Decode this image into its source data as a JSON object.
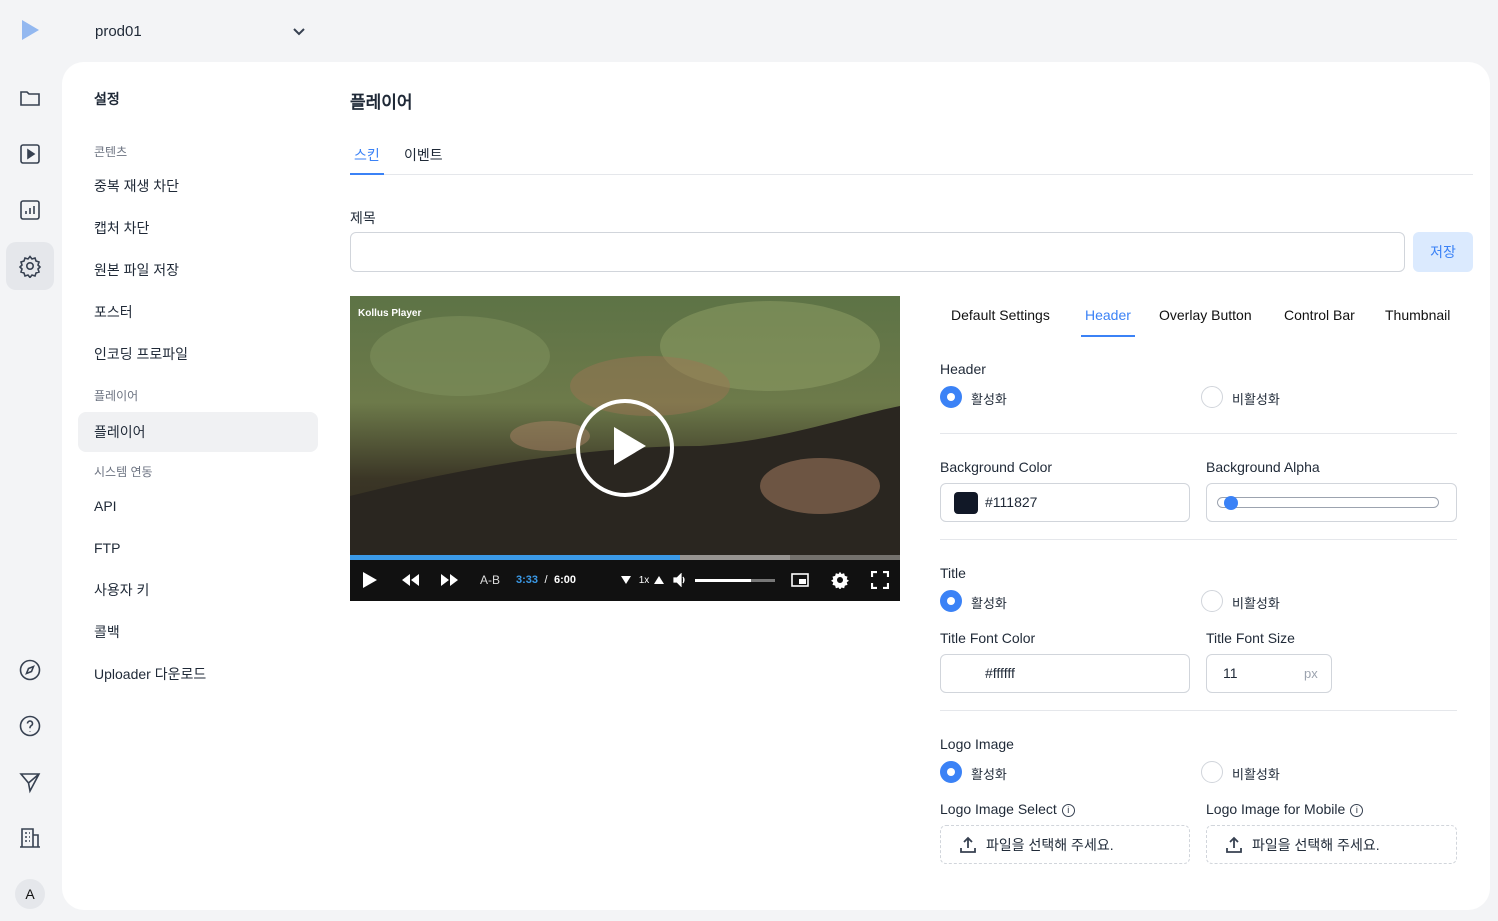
{
  "project": {
    "name": "prod01"
  },
  "nav": {
    "rail": [
      "folder-icon",
      "play-icon",
      "chart-icon",
      "gear-icon",
      "compass-icon",
      "help-icon",
      "send-icon",
      "building-icon"
    ],
    "avatar": "A"
  },
  "sidebar": {
    "title": "설정",
    "sections": [
      {
        "label": "콘텐츠",
        "items": [
          "중복 재생 차단",
          "캡처 차단",
          "원본 파일 저장",
          "포스터",
          "인코딩 프로파일"
        ]
      },
      {
        "label": "플레이어",
        "items": [
          "플레이어"
        ]
      },
      {
        "label": "시스템 연동",
        "items": [
          "API",
          "FTP",
          "사용자 키",
          "콜백",
          "Uploader 다운로드"
        ]
      }
    ],
    "active": "플레이어"
  },
  "page": {
    "title": "플레이어",
    "tabs": [
      {
        "label": "스킨",
        "active": true
      },
      {
        "label": "이벤트",
        "active": false
      }
    ],
    "name_label": "제목",
    "name_value": "",
    "save_label": "저장"
  },
  "player": {
    "brand": "Kollus Player",
    "ab_label": "A-B",
    "current_time": "3:33",
    "separator": "/",
    "duration": "6:00",
    "speed": "1x",
    "progress": 0.6,
    "buffered": 0.8,
    "volume": 0.7
  },
  "settings": {
    "tabs": [
      "Default Settings",
      "Header",
      "Overlay Button",
      "Control Bar",
      "Thumbnail"
    ],
    "active_tab": "Header",
    "enable_label": "활성화",
    "disable_label": "비활성화",
    "header": {
      "label": "Header",
      "enabled": true
    },
    "bg_color": {
      "label": "Background Color",
      "value": "#111827"
    },
    "bg_alpha": {
      "label": "Background Alpha",
      "value": 0
    },
    "title": {
      "label": "Title",
      "enabled": true
    },
    "title_font_color": {
      "label": "Title Font Color",
      "value": "#ffffff"
    },
    "title_font_size": {
      "label": "Title Font Size",
      "value": "11",
      "unit": "px"
    },
    "logo": {
      "label": "Logo Image",
      "enabled": true
    },
    "logo_select": {
      "label": "Logo Image Select",
      "placeholder": "파일을 선택해 주세요."
    },
    "logo_mobile": {
      "label": "Logo Image for Mobile",
      "placeholder": "파일을 선택해 주세요."
    },
    "info_glyph": "i"
  },
  "colors": {
    "accent": "#3b82f6",
    "save_bg": "#dbeafe",
    "progress": "#3b9ae8"
  }
}
